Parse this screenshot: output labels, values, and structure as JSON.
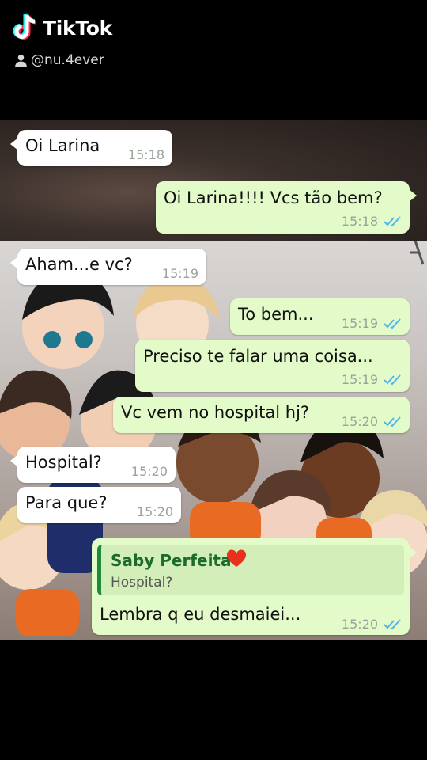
{
  "watermark": {
    "brand": "TikTok",
    "username": "@nu.4ever",
    "icons": [
      "tiktok-note-icon",
      "person-icon"
    ]
  },
  "messages": [
    {
      "text": "Oi Larina",
      "time": "15:18",
      "direction": "incoming"
    },
    {
      "text": "Oi Larina!!!! Vcs tão bem?",
      "time": "15:18",
      "direction": "outgoing",
      "read": true
    },
    {
      "text": "Aham...e vc?",
      "time": "15:19",
      "direction": "incoming"
    },
    {
      "text": "To bem...",
      "time": "15:19",
      "direction": "outgoing",
      "read": true
    },
    {
      "text": "Preciso te falar uma coisa...",
      "time": "15:19",
      "direction": "outgoing",
      "read": true
    },
    {
      "text": "Vc vem no hospital hj?",
      "time": "15:20",
      "direction": "outgoing",
      "read": true
    },
    {
      "text": "Hospital?",
      "time": "15:20",
      "direction": "incoming"
    },
    {
      "text": "Para que?",
      "time": "15:20",
      "direction": "incoming"
    },
    {
      "text": "Lembra q eu desmaiei...",
      "time": "15:20",
      "direction": "outgoing",
      "read": true,
      "reply_to": {
        "name": "Saby Perfeita",
        "emoji_icon": "red-heart-icon",
        "text": "Hospital?"
      }
    }
  ],
  "colors": {
    "incoming_bubble": "#ffffff",
    "outgoing_bubble": "#e2fbc9",
    "read_ticks": "#4fb4f0",
    "quote_bar": "#1f8a3a",
    "page_bg": "#000000"
  }
}
